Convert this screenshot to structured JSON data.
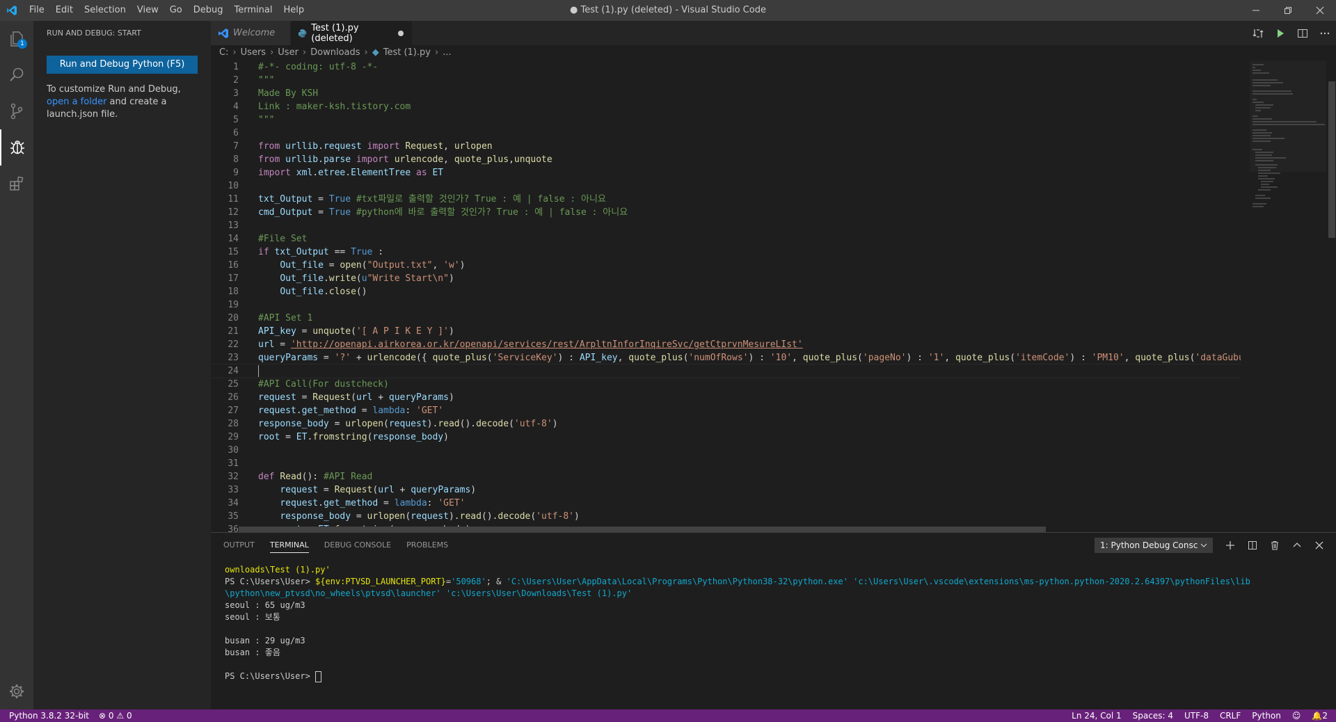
{
  "titlebar": {
    "menu": [
      "File",
      "Edit",
      "Selection",
      "View",
      "Go",
      "Debug",
      "Terminal",
      "Help"
    ],
    "window_title": "● Test (1).py (deleted) - Visual Studio Code"
  },
  "sidebar": {
    "title": "RUN AND DEBUG: START",
    "run_button": "Run and Debug Python (F5)",
    "text_before": "To customize Run and Debug, ",
    "link": "open a folder",
    "text_after": " and create a launch.json file.",
    "explorer_badge": "1"
  },
  "tabs": [
    {
      "label": "Welcome"
    },
    {
      "label": "Test (1).py (deleted)"
    }
  ],
  "breadcrumb": [
    "C:",
    "Users",
    "User",
    "Downloads",
    "Test (1).py",
    "..."
  ],
  "code_lines": [
    "#-*- coding: utf-8 -*-",
    "\"\"\"",
    "Made By KSH",
    "Link : maker-ksh.tistory.com",
    "\"\"\"",
    "",
    "from urllib.request import Request, urlopen",
    "from urllib.parse import urlencode, quote_plus,unquote",
    "import xml.etree.ElementTree as ET",
    "",
    "txt_Output = True #txt파일로 출력할 것인가? True : 예 | false : 아니요",
    "cmd_Output = True #python에 바로 출력할 것인가? True : 예 | false : 아니요",
    "",
    "#File Set",
    "if txt_Output == True :",
    "    Out_file = open(\"Output.txt\", 'w')",
    "    Out_file.write(u\"Write Start\\n\")",
    "    Out_file.close()",
    "",
    "#API Set 1",
    "API_key = unquote('[ A P I K E Y ]')",
    "url = 'http://openapi.airkorea.or.kr/openapi/services/rest/ArpltnInforInqireSvc/getCtprvnMesureLIst'",
    "queryParams = '?' + urlencode({ quote_plus('ServiceKey') : API_key, quote_plus('numOfRows') : '10', quote_plus('pageNo') : '1', quote_plus('itemCode') : 'PM10', quote_plus('dataGubun')",
    "",
    "#API Call(For dustcheck)",
    "request = Request(url + queryParams)",
    "request.get_method = lambda: 'GET'",
    "response_body = urlopen(request).read().decode('utf-8')",
    "root = ET.fromstring(response_body)",
    "",
    "",
    "def Read(): #API Read",
    "    request = Request(url + queryParams)",
    "    request.get_method = lambda: 'GET'",
    "    response_body = urlopen(request).read().decode('utf-8')",
    "    root = ET.fromstring(response_body)"
  ],
  "panel": {
    "tabs": [
      "OUTPUT",
      "TERMINAL",
      "DEBUG CONSOLE",
      "PROBLEMS"
    ],
    "terminal_select": "1: Python Debug Consc"
  },
  "terminal": {
    "line1": "ownloads\\Test (1).py'",
    "prompt": "PS C:\\Users\\User> ",
    "env": "${env:PTVSD_LAUNCHER_PORT}",
    "eq": "=",
    "port": "'50968'",
    "amp": "; & ",
    "python_path": "'C:\\Users\\User\\AppData\\Local\\Programs\\Python\\Python38-32\\python.exe'",
    "ext_path": " 'c:\\Users\\User\\.vscode\\extensions\\ms-python.python-2020.2.64397\\pythonFiles\\lib",
    "line3": "\\python\\new_ptvsd\\no_wheels\\ptvsd\\launcher'",
    "file_path": " 'c:\\Users\\User\\Downloads\\Test (1).py'",
    "out1": "seoul : 65 ug/m3",
    "out2": "seoul : 보통",
    "out3": "busan : 29 ug/m3",
    "out4": "busan : 좋음",
    "final_prompt": "PS C:\\Users\\User> "
  },
  "statusbar": {
    "python": "Python 3.8.2 32-bit",
    "errors": "0",
    "warnings": "0",
    "position": "Ln 24, Col 1",
    "spaces": "Spaces: 4",
    "encoding": "UTF-8",
    "eol": "CRLF",
    "language": "Python",
    "notifications": "2"
  },
  "colors": {
    "statusbar": "#68217a",
    "accent": "#0e639c",
    "link": "#3794ff"
  }
}
